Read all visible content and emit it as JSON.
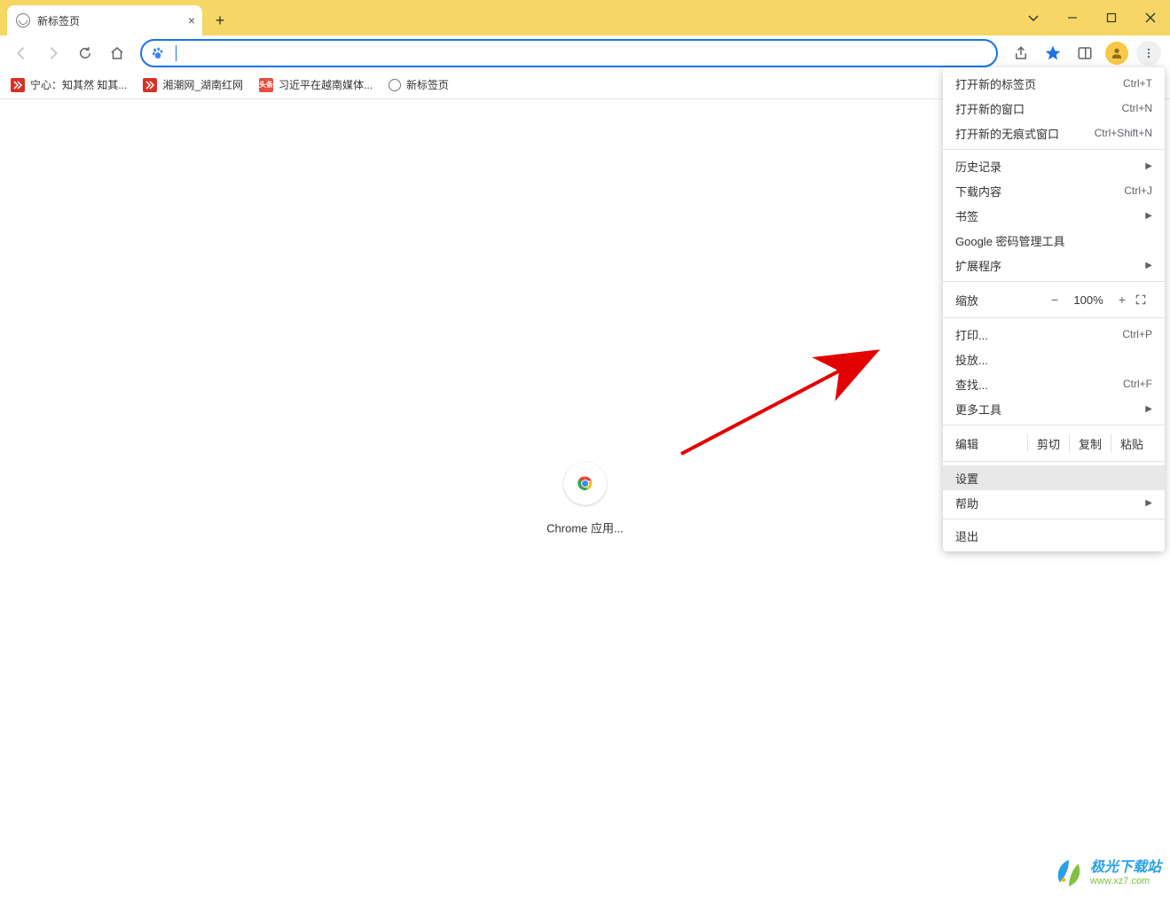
{
  "window": {
    "tab_title": "新标签页",
    "controls": {
      "chevron": "⌄",
      "minimize": "—",
      "maximize": "□",
      "close": "✕"
    }
  },
  "nav": {
    "back": "←",
    "forward": "→",
    "reload": "↻",
    "home": "⌂"
  },
  "address": {
    "value": ""
  },
  "toolbar": {
    "share": "",
    "star": "",
    "panel": "",
    "profile": "",
    "more": "⋮"
  },
  "bookmarks": [
    {
      "icon": "red",
      "label": "宁心：知其然 知其..."
    },
    {
      "icon": "red2",
      "label": "湘潮网_湖南红网"
    },
    {
      "icon": "toutiao",
      "label": "习近平在越南媒体..."
    },
    {
      "icon": "globe",
      "label": "新标签页"
    }
  ],
  "center": {
    "app_label": "Chrome 应用..."
  },
  "menu": {
    "new_tab": {
      "label": "打开新的标签页",
      "shortcut": "Ctrl+T"
    },
    "new_window": {
      "label": "打开新的窗口",
      "shortcut": "Ctrl+N"
    },
    "new_incognito": {
      "label": "打开新的无痕式窗口",
      "shortcut": "Ctrl+Shift+N"
    },
    "history": {
      "label": "历史记录"
    },
    "downloads": {
      "label": "下载内容",
      "shortcut": "Ctrl+J"
    },
    "bookmarks": {
      "label": "书签"
    },
    "passwords": {
      "label": "Google 密码管理工具"
    },
    "extensions": {
      "label": "扩展程序"
    },
    "zoom": {
      "label": "缩放",
      "minus": "−",
      "value": "100%",
      "plus": "+"
    },
    "print": {
      "label": "打印...",
      "shortcut": "Ctrl+P"
    },
    "cast": {
      "label": "投放..."
    },
    "find": {
      "label": "查找...",
      "shortcut": "Ctrl+F"
    },
    "more_tools": {
      "label": "更多工具"
    },
    "edit": {
      "label": "编辑",
      "cut": "剪切",
      "copy": "复制",
      "paste": "粘贴"
    },
    "settings": {
      "label": "设置"
    },
    "help": {
      "label": "帮助"
    },
    "exit": {
      "label": "退出"
    }
  },
  "watermark": {
    "line1": "极光下载站",
    "line2": "www.xz7.com"
  }
}
